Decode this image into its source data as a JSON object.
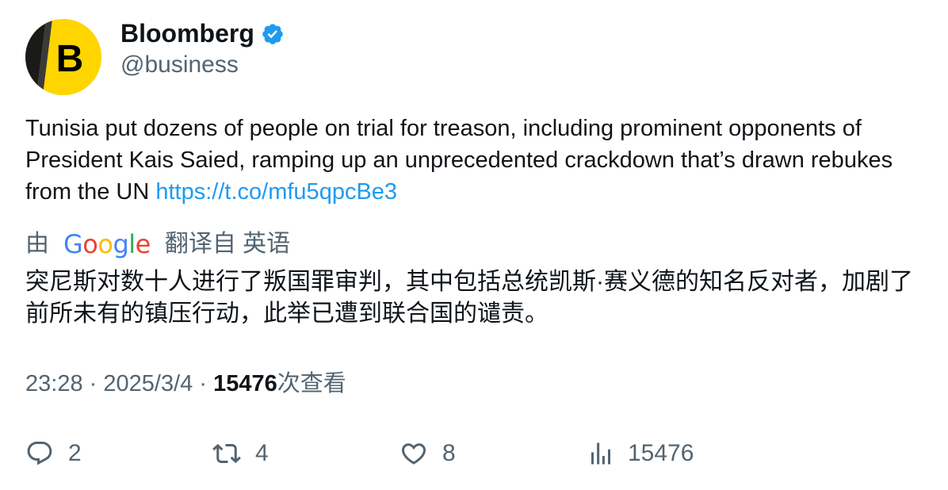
{
  "author": {
    "name": "Bloomberg",
    "handle": "@business",
    "avatar_letter": "B",
    "avatar_color": "#ffd500",
    "verified": true,
    "verified_color": "#1d9bf0"
  },
  "tweet": {
    "text": "Tunisia put dozens of people on trial for treason, including prominent opponents of President Kais Saied, ramping up an unprecedented crackdown that’s drawn rebukes from the UN ",
    "link": "https://t.co/mfu5qpcBe3"
  },
  "translation": {
    "prefix": "由",
    "provider_letters": [
      "G",
      "o",
      "o",
      "g",
      "l",
      "e"
    ],
    "suffix": "翻译自 英语",
    "text": "突尼斯对数十人进行了叛国罪审判，其中包括总统凯斯·赛义德的知名反对者，加剧了前所未有的镇压行动，此举已遭到联合国的谴责。"
  },
  "meta": {
    "time": "23:28",
    "separator": "·",
    "date": "2025/3/4",
    "views_count": "15476",
    "views_label": "次查看"
  },
  "actions": {
    "replies": "2",
    "retweets": "4",
    "likes": "8",
    "views": "15476"
  },
  "icons": {
    "reply": "reply-icon",
    "retweet": "retweet-icon",
    "like": "heart-icon",
    "views": "analytics-icon",
    "verified": "verified-badge-icon"
  },
  "colors": {
    "text_primary": "#0f1419",
    "text_secondary": "#536471",
    "link": "#1d9bf0"
  }
}
